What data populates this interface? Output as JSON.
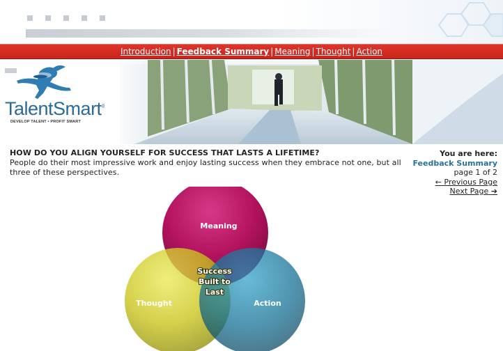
{
  "nav": {
    "items": [
      {
        "label": "Introduction",
        "current": false
      },
      {
        "label": "Feedback Summary",
        "current": true
      },
      {
        "label": "Meaning",
        "current": false
      },
      {
        "label": "Thought",
        "current": false
      },
      {
        "label": "Action",
        "current": false
      }
    ],
    "separator": "|"
  },
  "logo": {
    "name": "TalentSmart",
    "trademark": "®",
    "tagline": "DEVELOP TALENT • PROFIT SMART"
  },
  "content": {
    "headline": "HOW DO YOU ALIGN YOURSELF FOR SUCCESS THAT LASTS A LIFETIME?",
    "intro": "People do their most impressive work and enjoy lasting success when they embrace not one, but all three of these perspectives."
  },
  "location": {
    "label": "You are here:",
    "section": "Feedback Summary",
    "page": "page 1 of 2",
    "prev_label": "Previous Page",
    "prev_arrow": "←",
    "next_label": "Next Page",
    "next_arrow": "➔"
  },
  "venn": {
    "meaning": "Meaning",
    "thought": "Thought",
    "action": "Action",
    "center": [
      "Success",
      "Built to",
      "Last"
    ]
  },
  "colors": {
    "nav_red": "#d42e24",
    "logo_blue": "#2a6b9a",
    "meaning": "#b3135f",
    "thought": "#c9c41a",
    "action": "#0f6f95",
    "section_blue": "#2a7397"
  }
}
